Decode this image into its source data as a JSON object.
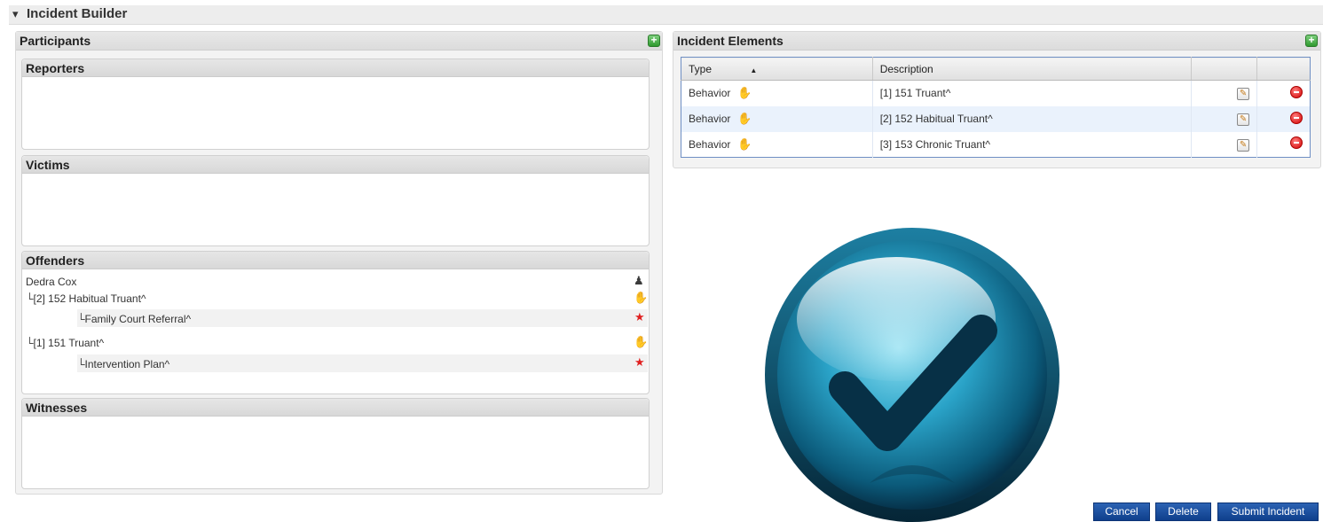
{
  "header": {
    "toggle_glyph": "▾",
    "title": "Incident Builder"
  },
  "participants": {
    "title": "Participants",
    "add_glyph": "+",
    "reporters": {
      "title": "Reporters"
    },
    "victims": {
      "title": "Victims"
    },
    "offenders": {
      "title": "Offenders",
      "name": "Dedra Cox",
      "items": [
        {
          "label": "└[2] 152 Habitual Truant^",
          "icon": "hand-icon"
        },
        {
          "label": "└Family Court Referral^",
          "icon": "star-icon"
        },
        {
          "label": "└[1] 151 Truant^",
          "icon": "hand-icon"
        },
        {
          "label": "└Intervention Plan^",
          "icon": "star-icon"
        }
      ]
    },
    "witnesses": {
      "title": "Witnesses"
    }
  },
  "incident_elements": {
    "title": "Incident Elements",
    "add_glyph": "+",
    "columns": {
      "type": "Type",
      "sort_glyph": "▲",
      "description": "Description"
    },
    "rows": [
      {
        "type": "Behavior",
        "description": "[1] 151 Truant^"
      },
      {
        "type": "Behavior",
        "description": "[2] 152 Habitual Truant^"
      },
      {
        "type": "Behavior",
        "description": "[3] 153 Chronic Truant^"
      }
    ]
  },
  "overlay": {
    "icon": "checkmark-badge-icon",
    "color": "#2aa3c8"
  },
  "buttons": {
    "cancel": "Cancel",
    "delete": "Delete",
    "submit": "Submit Incident"
  },
  "colors": {
    "button_blue": "#1a4d9e",
    "grid_border": "#6f8fc4",
    "row_alt": "#eaf2fc"
  }
}
